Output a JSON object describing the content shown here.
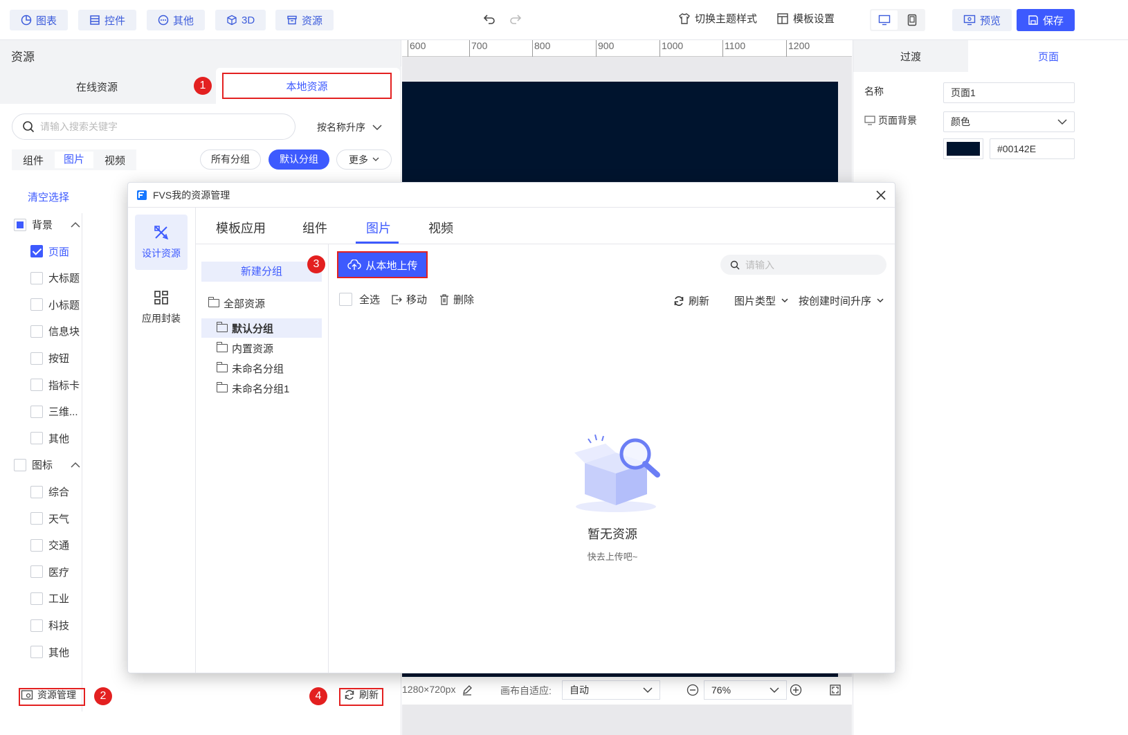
{
  "topbar": {
    "items": [
      {
        "icon": "chart-icon",
        "label": "图表"
      },
      {
        "icon": "widget-icon",
        "label": "控件"
      },
      {
        "icon": "more-circle-icon",
        "label": "其他"
      },
      {
        "icon": "cube-icon",
        "label": "3D"
      },
      {
        "icon": "archive-icon",
        "label": "资源"
      }
    ],
    "theme_label": "切换主题样式",
    "template_label": "模板设置",
    "preview_label": "预览",
    "save_label": "保存"
  },
  "left": {
    "title": "资源",
    "tab_online": "在线资源",
    "tab_local": "本地资源",
    "search_placeholder": "请输入搜索关键字",
    "sort_label": "按名称升序",
    "types": [
      "组件",
      "图片",
      "视频"
    ],
    "group_all": "所有分组",
    "group_default": "默认分组",
    "group_more": "更多",
    "clear_select": "清空选择",
    "tree": [
      {
        "label": "背景",
        "level": 0,
        "state": "part",
        "expand": true
      },
      {
        "label": "页面",
        "level": 1,
        "state": "on"
      },
      {
        "label": "大标题",
        "level": 1,
        "state": "off"
      },
      {
        "label": "小标题",
        "level": 1,
        "state": "off"
      },
      {
        "label": "信息块",
        "level": 1,
        "state": "off"
      },
      {
        "label": "按钮",
        "level": 1,
        "state": "off"
      },
      {
        "label": "指标卡",
        "level": 1,
        "state": "off"
      },
      {
        "label": "三维...",
        "level": 1,
        "state": "off"
      },
      {
        "label": "其他",
        "level": 1,
        "state": "off"
      },
      {
        "label": "图标",
        "level": 0,
        "state": "off",
        "expand": true
      },
      {
        "label": "综合",
        "level": 1,
        "state": "off"
      },
      {
        "label": "天气",
        "level": 1,
        "state": "off"
      },
      {
        "label": "交通",
        "level": 1,
        "state": "off"
      },
      {
        "label": "医疗",
        "level": 1,
        "state": "off"
      },
      {
        "label": "工业",
        "level": 1,
        "state": "off"
      },
      {
        "label": "科技",
        "level": 1,
        "state": "off"
      },
      {
        "label": "其他",
        "level": 1,
        "state": "off"
      }
    ],
    "manage_label": "资源管理",
    "refresh_label": "刷新"
  },
  "ruler": [
    "600",
    "700",
    "800",
    "900",
    "1000",
    "1100",
    "1200"
  ],
  "canvas": {
    "size_label": "1280×720px",
    "fit_label": "画布自适应:",
    "fit_value": "自动",
    "zoom": "76%",
    "bg_color": "#00142E"
  },
  "right": {
    "tab_transition": "过渡",
    "tab_page": "页面",
    "name_label": "名称",
    "name_value": "页面1",
    "bg_label": "页面背景",
    "bg_type": "颜色",
    "color_value": "#00142E"
  },
  "modal": {
    "title": "FVS我的资源管理",
    "side": [
      {
        "icon": "design-tools-icon",
        "label": "设计资源"
      },
      {
        "icon": "app-grid-icon",
        "label": "应用封装"
      }
    ],
    "tabs": [
      "模板应用",
      "组件",
      "图片",
      "视频"
    ],
    "new_group": "新建分组",
    "groups": [
      "全部资源",
      "默认分组",
      "内置资源",
      "未命名分组",
      "未命名分组1"
    ],
    "upload_label": "从本地上传",
    "search_placeholder": "请输入",
    "select_all": "全选",
    "move": "移动",
    "delete": "删除",
    "refresh": "刷新",
    "type_filter": "图片类型",
    "sort": "按创建时间升序",
    "empty_title": "暂无资源",
    "empty_sub": "快去上传吧~"
  },
  "badges": [
    "1",
    "2",
    "3",
    "4"
  ],
  "colors": {
    "accent": "#3d5afe",
    "annotation": "#e32020",
    "canvas": "#00142e"
  }
}
